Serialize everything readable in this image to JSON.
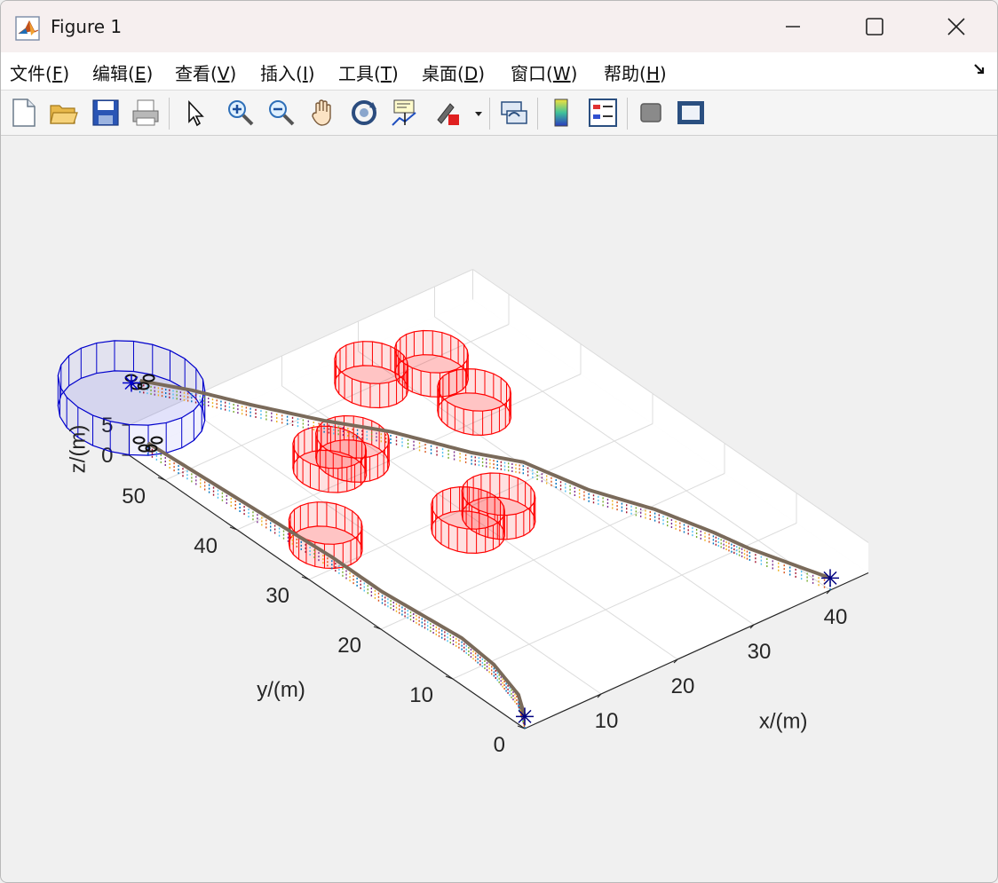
{
  "window": {
    "title": "Figure 1"
  },
  "menu": [
    {
      "label": "文件(",
      "key": "F",
      "tail": ")"
    },
    {
      "label": "编辑(",
      "key": "E",
      "tail": ")"
    },
    {
      "label": "查看(",
      "key": "V",
      "tail": ")"
    },
    {
      "label": "插入(",
      "key": "I",
      "tail": ")"
    },
    {
      "label": "工具(",
      "key": "T",
      "tail": ")"
    },
    {
      "label": "桌面(",
      "key": "D",
      "tail": ")"
    },
    {
      "label": "窗口(",
      "key": "W",
      "tail": ")"
    },
    {
      "label": "帮助(",
      "key": "H",
      "tail": ")"
    }
  ],
  "toolbar": {
    "icons": [
      "new-figure-icon",
      "open-file-icon",
      "save-icon",
      "print-icon",
      "edit-plot-arrow-icon",
      "zoom-in-icon",
      "zoom-out-icon",
      "pan-hand-icon",
      "rotate-3d-icon",
      "data-cursor-icon",
      "brush-icon",
      "link-plot-icon",
      "colorbar-icon",
      "legend-icon",
      "hide-plot-tools-icon",
      "show-plot-tools-icon"
    ]
  },
  "chart_data": {
    "type": "line3d",
    "xlabel": "x/(m)",
    "ylabel": "y/(m)",
    "zlabel": "z/(m)",
    "xlim": [
      0,
      45
    ],
    "ylim": [
      0,
      55
    ],
    "zlim": [
      0,
      5
    ],
    "xticks": [
      "10",
      "20",
      "30",
      "40"
    ],
    "yticks": [
      "0",
      "10",
      "20",
      "30",
      "40",
      "50"
    ],
    "zticks": [
      "0",
      "5"
    ],
    "grid": true,
    "colors": {
      "obstacle": "#ff0000",
      "goal_region": "#0000cc",
      "path_marker": "#000080"
    },
    "obstacles": [
      {
        "cx": 5,
        "cy": 33,
        "r": 3.5,
        "h": 4
      },
      {
        "cx": 14,
        "cy": 42,
        "r": 3.5,
        "h": 4
      },
      {
        "cx": 17,
        "cy": 42,
        "r": 3.5,
        "h": 4
      },
      {
        "cx": 18,
        "cy": 27,
        "r": 3.5,
        "h": 4
      },
      {
        "cx": 22,
        "cy": 27,
        "r": 3.5,
        "h": 4
      },
      {
        "cx": 27,
        "cy": 50,
        "r": 3.5,
        "h": 4
      },
      {
        "cx": 33,
        "cy": 48,
        "r": 3.5,
        "h": 4
      },
      {
        "cx": 32,
        "cy": 41,
        "r": 3.5,
        "h": 4
      }
    ],
    "target_ring": {
      "cx": 5,
      "cy": 60,
      "r": 7,
      "h": 5
    },
    "series": [
      {
        "x": [
          0,
          2,
          3.5,
          4,
          3.5,
          3,
          3,
          2.5,
          2,
          1.5
        ],
        "y": [
          0,
          3,
          8,
          13,
          18,
          23,
          30,
          38,
          46,
          54
        ],
        "z": [
          2,
          2,
          2,
          2,
          2,
          2,
          2,
          2,
          2,
          2
        ]
      },
      {
        "x": [
          40,
          37,
          36,
          34,
          31,
          29,
          26,
          22,
          18,
          14,
          11,
          8
        ],
        "y": [
          0,
          8,
          12,
          18,
          24,
          31,
          35,
          42,
          47,
          53,
          58,
          62
        ],
        "z": [
          2,
          2,
          2,
          2,
          2,
          2,
          2,
          2,
          2,
          2,
          2,
          2
        ]
      }
    ]
  }
}
